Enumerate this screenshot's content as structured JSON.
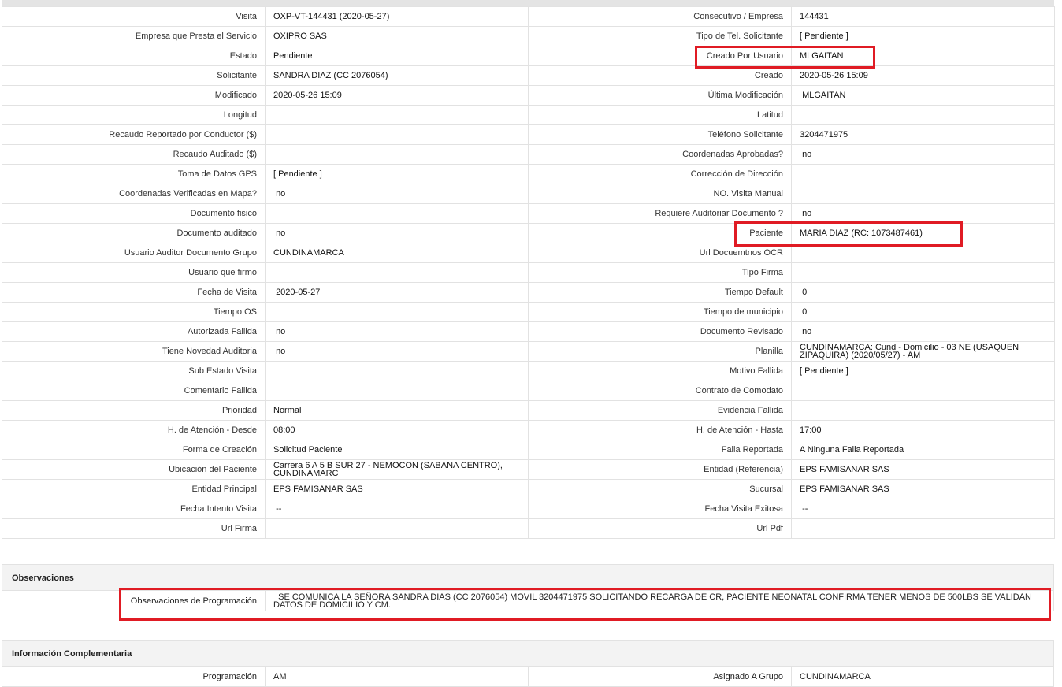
{
  "rows": [
    {
      "l1": "Visita",
      "v1": "OXP-VT-144431 (2020-05-27)",
      "l2": "Consecutivo / Empresa",
      "v2": "144431"
    },
    {
      "l1": "Empresa que Presta el Servicio",
      "v1": "OXIPRO SAS",
      "l2": "Tipo de Tel. Solicitante",
      "v2": "[ Pendiente ]"
    },
    {
      "l1": "Estado",
      "v1": "Pendiente",
      "l2": "Creado Por Usuario",
      "v2": "MLGAITAN"
    },
    {
      "l1": "Solicitante",
      "v1": "SANDRA DIAZ (CC 2076054)",
      "l2": "Creado",
      "v2": "2020-05-26 15:09"
    },
    {
      "l1": "Modificado",
      "v1": "2020-05-26 15:09",
      "l2": "Última Modificación",
      "v2": " MLGAITAN"
    },
    {
      "l1": "Longitud",
      "v1": "",
      "l2": "Latitud",
      "v2": ""
    },
    {
      "l1": "Recaudo Reportado por Conductor ($)",
      "v1": "",
      "l2": "Teléfono Solicitante",
      "v2": "3204471975"
    },
    {
      "l1": "Recaudo Auditado ($)",
      "v1": "",
      "l2": "Coordenadas Aprobadas?",
      "v2": " no"
    },
    {
      "l1": "Toma de Datos GPS",
      "v1": "[ Pendiente ]",
      "l2": "Corrección de Dirección",
      "v2": ""
    },
    {
      "l1": "Coordenadas Verificadas en Mapa?",
      "v1": " no",
      "l2": "NO. Visita Manual",
      "v2": ""
    },
    {
      "l1": "Documento fisico",
      "v1": "",
      "l2": "Requiere Auditoriar Documento ?",
      "v2": " no"
    },
    {
      "l1": "Documento auditado",
      "v1": " no",
      "l2": "Paciente",
      "v2": "MARIA DIAZ (RC: 1073487461)"
    },
    {
      "l1": "Usuario Auditor Documento Grupo",
      "v1": "CUNDINAMARCA",
      "l2": "Url Docuemtnos OCR",
      "v2": ""
    },
    {
      "l1": "Usuario que firmo",
      "v1": "",
      "l2": "Tipo Firma",
      "v2": ""
    },
    {
      "l1": "Fecha de Visita",
      "v1": " 2020-05-27",
      "l2": "Tiempo Default",
      "v2": " 0"
    },
    {
      "l1": "Tiempo OS",
      "v1": "",
      "l2": "Tiempo de municipio",
      "v2": " 0"
    },
    {
      "l1": "Autorizada Fallida",
      "v1": " no",
      "l2": "Documento Revisado",
      "v2": " no"
    },
    {
      "l1": "Tiene Novedad Auditoria",
      "v1": " no",
      "l2": "Planilla",
      "v2": "CUNDINAMARCA: Cund - Domicilio - 03 NE (USAQUEN ZIPAQUIRA) (2020/05/27) - AM"
    },
    {
      "l1": "Sub Estado Visita",
      "v1": "",
      "l2": "Motivo Fallida",
      "v2": "[ Pendiente ]"
    },
    {
      "l1": "Comentario Fallida",
      "v1": "",
      "l2": "Contrato de Comodato",
      "v2": ""
    },
    {
      "l1": "Prioridad",
      "v1": "Normal",
      "l2": "Evidencia Fallida",
      "v2": ""
    },
    {
      "l1": "H. de Atención - Desde",
      "v1": "08:00",
      "l2": "H. de Atención - Hasta",
      "v2": "17:00"
    },
    {
      "l1": "Forma de Creación",
      "v1": "Solicitud Paciente",
      "l2": "Falla Reportada",
      "v2": "A Ninguna Falla Reportada"
    },
    {
      "l1": "Ubicación del Paciente",
      "v1": "Carrera 6 A 5 B SUR 27 - NEMOCON (SABANA CENTRO), CUNDINAMARC",
      "l2": "Entidad (Referencia)",
      "v2": "EPS FAMISANAR SAS"
    },
    {
      "l1": "Entidad Principal",
      "v1": "EPS FAMISANAR SAS",
      "l2": "Sucursal",
      "v2": "EPS FAMISANAR SAS"
    },
    {
      "l1": "Fecha Intento Visita",
      "v1": " --",
      "l2": "Fecha Visita Exitosa",
      "v2": " --"
    },
    {
      "l1": "Url Firma",
      "v1": "",
      "l2": "Url Pdf",
      "v2": ""
    }
  ],
  "observaciones": {
    "title": "Observaciones",
    "label": "Observaciones de Programación",
    "value": "  SE COMUNICA LA SEÑORA SANDRA DIAS (CC 2076054) MOVIL 3204471975 SOLICITANDO RECARGA DE CR, PACIENTE NEONATAL CONFIRMA TENER MENOS DE 500LBS SE VALIDAN DATOS DE DOMICILIO Y CM."
  },
  "complementaria": {
    "title": "Información Complementaria",
    "l1": "Programación",
    "v1": "AM",
    "l2": "Asignado A Grupo",
    "v2": "CUNDINAMARCA"
  },
  "highlight_color": "#e01b24"
}
